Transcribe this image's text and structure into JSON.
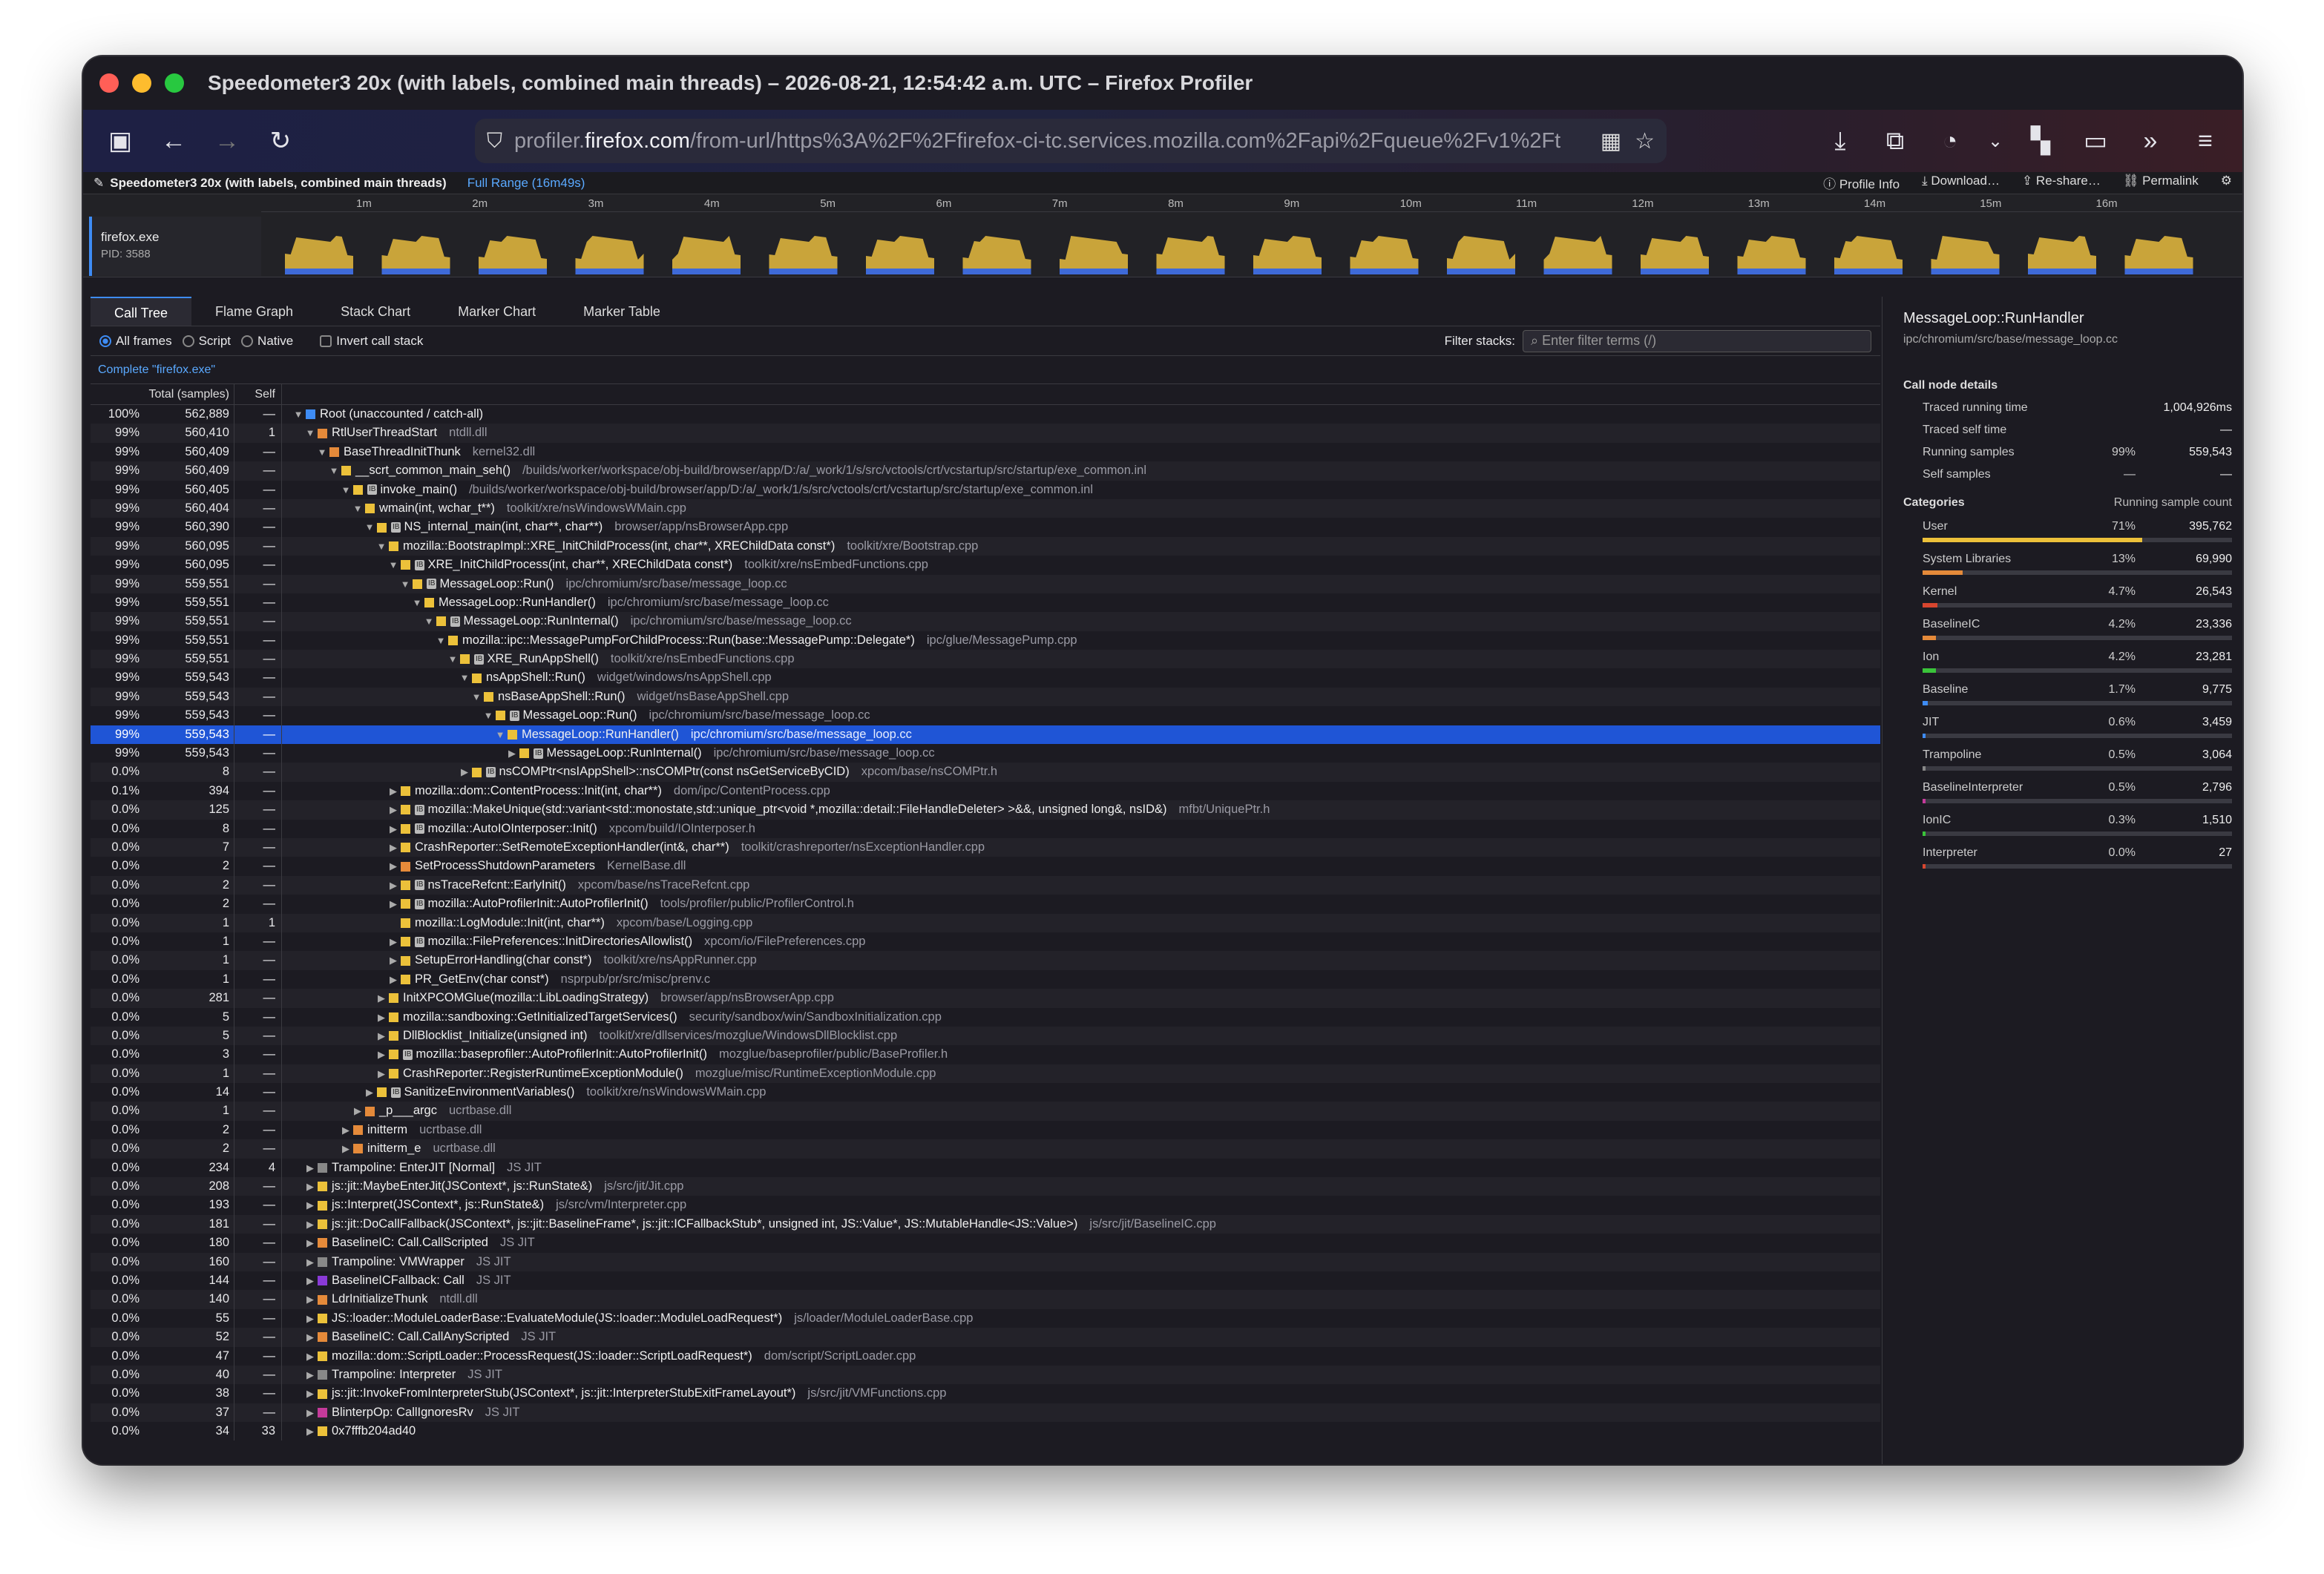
{
  "window": {
    "title": "Speedometer3 20x (with labels, combined main threads) – 2026-08-21, 12:54:42 a.m. UTC – Firefox Profiler"
  },
  "browser": {
    "url_prefix": "profiler.",
    "url_domain": "firefox.com",
    "url_path": "/from-url/https%3A%2F%2Ffirefox-ci-tc.services.mozilla.com%2Fapi%2Fqueue%2Fv1%2Ft"
  },
  "profile_header": {
    "name": "Speedometer3 20x (with labels, combined main threads)",
    "range": "Full Range (16m49s)",
    "buttons": [
      "Profile Info",
      "Download…",
      "Re-share…",
      "Permalink"
    ]
  },
  "timeline": {
    "ticks": [
      "1m",
      "2m",
      "3m",
      "4m",
      "5m",
      "6m",
      "7m",
      "8m",
      "9m",
      "10m",
      "11m",
      "12m",
      "13m",
      "14m",
      "15m",
      "16m"
    ],
    "track_name": "firefox.exe",
    "track_pid": "PID: 3588"
  },
  "tabs": [
    "Call Tree",
    "Flame Graph",
    "Stack Chart",
    "Marker Chart",
    "Marker Table"
  ],
  "settings": {
    "all_frames": "All frames",
    "script": "Script",
    "native": "Native",
    "invert": "Invert call stack",
    "filter_label": "Filter stacks:",
    "filter_placeholder": "Enter filter terms (/)"
  },
  "breadcrumb": "Complete \"firefox.exe\"",
  "columns": {
    "total": "Total (samples)",
    "self": "Self"
  },
  "colors": {
    "user": "#ecc13a",
    "syslib": "#e58a3a",
    "kernel": "#d7462f",
    "js": "#3e8cf5",
    "selected": "#1f55d6"
  },
  "rows": [
    {
      "pct": "100%",
      "total": "562,889",
      "self": "—",
      "depth": 0,
      "tw": "▼",
      "cat": "#3e8cf5",
      "ib": false,
      "name": "Root (unaccounted / catch-all)",
      "lib": ""
    },
    {
      "pct": "99%",
      "total": "560,410",
      "self": "1",
      "depth": 1,
      "tw": "▼",
      "cat": "#e58a3a",
      "ib": false,
      "name": "RtlUserThreadStart",
      "lib": "ntdll.dll"
    },
    {
      "pct": "99%",
      "total": "560,409",
      "self": "—",
      "depth": 2,
      "tw": "▼",
      "cat": "#e58a3a",
      "ib": false,
      "name": "BaseThreadInitThunk",
      "lib": "kernel32.dll"
    },
    {
      "pct": "99%",
      "total": "560,409",
      "self": "—",
      "depth": 3,
      "tw": "▼",
      "cat": "#ecc13a",
      "ib": false,
      "name": "__scrt_common_main_seh()",
      "lib": "/builds/worker/workspace/obj-build/browser/app/D:/a/_work/1/s/src/vctools/crt/vcstartup/src/startup/exe_common.inl"
    },
    {
      "pct": "99%",
      "total": "560,405",
      "self": "—",
      "depth": 4,
      "tw": "▼",
      "cat": "#ecc13a",
      "ib": true,
      "name": "invoke_main()",
      "lib": "/builds/worker/workspace/obj-build/browser/app/D:/a/_work/1/s/src/vctools/crt/vcstartup/src/startup/exe_common.inl"
    },
    {
      "pct": "99%",
      "total": "560,404",
      "self": "—",
      "depth": 5,
      "tw": "▼",
      "cat": "#ecc13a",
      "ib": false,
      "name": "wmain(int, wchar_t**)",
      "lib": "toolkit/xre/nsWindowsWMain.cpp"
    },
    {
      "pct": "99%",
      "total": "560,390",
      "self": "—",
      "depth": 6,
      "tw": "▼",
      "cat": "#ecc13a",
      "ib": true,
      "name": "NS_internal_main(int, char**, char**)",
      "lib": "browser/app/nsBrowserApp.cpp"
    },
    {
      "pct": "99%",
      "total": "560,095",
      "self": "—",
      "depth": 7,
      "tw": "▼",
      "cat": "#ecc13a",
      "ib": false,
      "name": "mozilla::BootstrapImpl::XRE_InitChildProcess(int, char**, XREChildData const*)",
      "lib": "toolkit/xre/Bootstrap.cpp"
    },
    {
      "pct": "99%",
      "total": "560,095",
      "self": "—",
      "depth": 8,
      "tw": "▼",
      "cat": "#ecc13a",
      "ib": true,
      "name": "XRE_InitChildProcess(int, char**, XREChildData const*)",
      "lib": "toolkit/xre/nsEmbedFunctions.cpp"
    },
    {
      "pct": "99%",
      "total": "559,551",
      "self": "—",
      "depth": 9,
      "tw": "▼",
      "cat": "#ecc13a",
      "ib": true,
      "name": "MessageLoop::Run()",
      "lib": "ipc/chromium/src/base/message_loop.cc"
    },
    {
      "pct": "99%",
      "total": "559,551",
      "self": "—",
      "depth": 10,
      "tw": "▼",
      "cat": "#ecc13a",
      "ib": false,
      "name": "MessageLoop::RunHandler()",
      "lib": "ipc/chromium/src/base/message_loop.cc"
    },
    {
      "pct": "99%",
      "total": "559,551",
      "self": "—",
      "depth": 11,
      "tw": "▼",
      "cat": "#ecc13a",
      "ib": true,
      "name": "MessageLoop::RunInternal()",
      "lib": "ipc/chromium/src/base/message_loop.cc"
    },
    {
      "pct": "99%",
      "total": "559,551",
      "self": "—",
      "depth": 12,
      "tw": "▼",
      "cat": "#ecc13a",
      "ib": false,
      "name": "mozilla::ipc::MessagePumpForChildProcess::Run(base::MessagePump::Delegate*)",
      "lib": "ipc/glue/MessagePump.cpp"
    },
    {
      "pct": "99%",
      "total": "559,551",
      "self": "—",
      "depth": 13,
      "tw": "▼",
      "cat": "#ecc13a",
      "ib": true,
      "name": "XRE_RunAppShell()",
      "lib": "toolkit/xre/nsEmbedFunctions.cpp"
    },
    {
      "pct": "99%",
      "total": "559,543",
      "self": "—",
      "depth": 14,
      "tw": "▼",
      "cat": "#ecc13a",
      "ib": false,
      "name": "nsAppShell::Run()",
      "lib": "widget/windows/nsAppShell.cpp"
    },
    {
      "pct": "99%",
      "total": "559,543",
      "self": "—",
      "depth": 15,
      "tw": "▼",
      "cat": "#ecc13a",
      "ib": false,
      "name": "nsBaseAppShell::Run()",
      "lib": "widget/nsBaseAppShell.cpp"
    },
    {
      "pct": "99%",
      "total": "559,543",
      "self": "—",
      "depth": 16,
      "tw": "▼",
      "cat": "#ecc13a",
      "ib": true,
      "name": "MessageLoop::Run()",
      "lib": "ipc/chromium/src/base/message_loop.cc"
    },
    {
      "pct": "99%",
      "total": "559,543",
      "self": "—",
      "depth": 17,
      "tw": "▼",
      "cat": "#ecc13a",
      "ib": false,
      "name": "MessageLoop::RunHandler()",
      "lib": "ipc/chromium/src/base/message_loop.cc",
      "sel": true
    },
    {
      "pct": "99%",
      "total": "559,543",
      "self": "—",
      "depth": 18,
      "tw": "▶",
      "cat": "#ecc13a",
      "ib": true,
      "name": "MessageLoop::RunInternal()",
      "lib": "ipc/chromium/src/base/message_loop.cc"
    },
    {
      "pct": "0.0%",
      "total": "8",
      "self": "—",
      "depth": 14,
      "tw": "▶",
      "cat": "#ecc13a",
      "ib": true,
      "name": "nsCOMPtr<nsIAppShell>::nsCOMPtr(const nsGetServiceByCID)",
      "lib": "xpcom/base/nsCOMPtr.h"
    },
    {
      "pct": "0.1%",
      "total": "394",
      "self": "—",
      "depth": 8,
      "tw": "▶",
      "cat": "#ecc13a",
      "ib": false,
      "name": "mozilla::dom::ContentProcess::Init(int, char**)",
      "lib": "dom/ipc/ContentProcess.cpp"
    },
    {
      "pct": "0.0%",
      "total": "125",
      "self": "—",
      "depth": 8,
      "tw": "▶",
      "cat": "#ecc13a",
      "ib": true,
      "name": "mozilla::MakeUnique(std::variant<std::monostate,std::unique_ptr<void *,mozilla::detail::FileHandleDeleter> >&&, unsigned long&, nsID&)",
      "lib": "mfbt/UniquePtr.h"
    },
    {
      "pct": "0.0%",
      "total": "8",
      "self": "—",
      "depth": 8,
      "tw": "▶",
      "cat": "#ecc13a",
      "ib": true,
      "name": "mozilla::AutoIOInterposer::Init()",
      "lib": "xpcom/build/IOInterposer.h"
    },
    {
      "pct": "0.0%",
      "total": "7",
      "self": "—",
      "depth": 8,
      "tw": "▶",
      "cat": "#ecc13a",
      "ib": false,
      "name": "CrashReporter::SetRemoteExceptionHandler(int&, char**)",
      "lib": "toolkit/crashreporter/nsExceptionHandler.cpp"
    },
    {
      "pct": "0.0%",
      "total": "2",
      "self": "—",
      "depth": 8,
      "tw": "▶",
      "cat": "#e58a3a",
      "ib": false,
      "name": "SetProcessShutdownParameters",
      "lib": "KernelBase.dll"
    },
    {
      "pct": "0.0%",
      "total": "2",
      "self": "—",
      "depth": 8,
      "tw": "▶",
      "cat": "#ecc13a",
      "ib": true,
      "name": "nsTraceRefcnt::EarlyInit()",
      "lib": "xpcom/base/nsTraceRefcnt.cpp"
    },
    {
      "pct": "0.0%",
      "total": "2",
      "self": "—",
      "depth": 8,
      "tw": "▶",
      "cat": "#ecc13a",
      "ib": true,
      "name": "mozilla::AutoProfilerInit::AutoProfilerInit()",
      "lib": "tools/profiler/public/ProfilerControl.h"
    },
    {
      "pct": "0.0%",
      "total": "1",
      "self": "1",
      "depth": 8,
      "tw": "",
      "cat": "#ecc13a",
      "ib": false,
      "name": "mozilla::LogModule::Init(int, char**)",
      "lib": "xpcom/base/Logging.cpp"
    },
    {
      "pct": "0.0%",
      "total": "1",
      "self": "—",
      "depth": 8,
      "tw": "▶",
      "cat": "#ecc13a",
      "ib": true,
      "name": "mozilla::FilePreferences::InitDirectoriesAllowlist()",
      "lib": "xpcom/io/FilePreferences.cpp"
    },
    {
      "pct": "0.0%",
      "total": "1",
      "self": "—",
      "depth": 8,
      "tw": "▶",
      "cat": "#ecc13a",
      "ib": false,
      "name": "SetupErrorHandling(char const*)",
      "lib": "toolkit/xre/nsAppRunner.cpp"
    },
    {
      "pct": "0.0%",
      "total": "1",
      "self": "—",
      "depth": 8,
      "tw": "▶",
      "cat": "#ecc13a",
      "ib": false,
      "name": "PR_GetEnv(char const*)",
      "lib": "nsprpub/pr/src/misc/prenv.c"
    },
    {
      "pct": "0.0%",
      "total": "281",
      "self": "—",
      "depth": 7,
      "tw": "▶",
      "cat": "#ecc13a",
      "ib": false,
      "name": "InitXPCOMGlue(mozilla::LibLoadingStrategy)",
      "lib": "browser/app/nsBrowserApp.cpp"
    },
    {
      "pct": "0.0%",
      "total": "5",
      "self": "—",
      "depth": 7,
      "tw": "▶",
      "cat": "#ecc13a",
      "ib": false,
      "name": "mozilla::sandboxing::GetInitializedTargetServices()",
      "lib": "security/sandbox/win/SandboxInitialization.cpp"
    },
    {
      "pct": "0.0%",
      "total": "5",
      "self": "—",
      "depth": 7,
      "tw": "▶",
      "cat": "#ecc13a",
      "ib": false,
      "name": "DllBlocklist_Initialize(unsigned int)",
      "lib": "toolkit/xre/dllservices/mozglue/WindowsDllBlocklist.cpp"
    },
    {
      "pct": "0.0%",
      "total": "3",
      "self": "—",
      "depth": 7,
      "tw": "▶",
      "cat": "#ecc13a",
      "ib": true,
      "name": "mozilla::baseprofiler::AutoProfilerInit::AutoProfilerInit()",
      "lib": "mozglue/baseprofiler/public/BaseProfiler.h"
    },
    {
      "pct": "0.0%",
      "total": "1",
      "self": "—",
      "depth": 7,
      "tw": "▶",
      "cat": "#ecc13a",
      "ib": false,
      "name": "CrashReporter::RegisterRuntimeExceptionModule()",
      "lib": "mozglue/misc/RuntimeExceptionModule.cpp"
    },
    {
      "pct": "0.0%",
      "total": "14",
      "self": "—",
      "depth": 6,
      "tw": "▶",
      "cat": "#ecc13a",
      "ib": true,
      "name": "SanitizeEnvironmentVariables()",
      "lib": "toolkit/xre/nsWindowsWMain.cpp"
    },
    {
      "pct": "0.0%",
      "total": "1",
      "self": "—",
      "depth": 5,
      "tw": "▶",
      "cat": "#e58a3a",
      "ib": false,
      "name": "_p___argc",
      "lib": "ucrtbase.dll"
    },
    {
      "pct": "0.0%",
      "total": "2",
      "self": "—",
      "depth": 4,
      "tw": "▶",
      "cat": "#e58a3a",
      "ib": false,
      "name": "initterm",
      "lib": "ucrtbase.dll"
    },
    {
      "pct": "0.0%",
      "total": "2",
      "self": "—",
      "depth": 4,
      "tw": "▶",
      "cat": "#e58a3a",
      "ib": false,
      "name": "initterm_e",
      "lib": "ucrtbase.dll"
    },
    {
      "pct": "0.0%",
      "total": "234",
      "self": "4",
      "depth": 1,
      "tw": "▶",
      "cat": "#888888",
      "ib": false,
      "name": "Trampoline: EnterJIT [Normal]",
      "lib": "JS JIT"
    },
    {
      "pct": "0.0%",
      "total": "208",
      "self": "—",
      "depth": 1,
      "tw": "▶",
      "cat": "#ecc13a",
      "ib": false,
      "name": "js::jit::MaybeEnterJit(JSContext*, js::RunState&)",
      "lib": "js/src/jit/Jit.cpp"
    },
    {
      "pct": "0.0%",
      "total": "193",
      "self": "—",
      "depth": 1,
      "tw": "▶",
      "cat": "#ecc13a",
      "ib": false,
      "name": "js::Interpret(JSContext*, js::RunState&)",
      "lib": "js/src/vm/Interpreter.cpp"
    },
    {
      "pct": "0.0%",
      "total": "181",
      "self": "—",
      "depth": 1,
      "tw": "▶",
      "cat": "#ecc13a",
      "ib": false,
      "name": "js::jit::DoCallFallback(JSContext*, js::jit::BaselineFrame*, js::jit::ICFallbackStub*, unsigned int, JS::Value*, JS::MutableHandle<JS::Value>)",
      "lib": "js/src/jit/BaselineIC.cpp"
    },
    {
      "pct": "0.0%",
      "total": "180",
      "self": "—",
      "depth": 1,
      "tw": "▶",
      "cat": "#e58a3a",
      "ib": false,
      "name": "BaselineIC: Call.CallScripted",
      "lib": "JS JIT"
    },
    {
      "pct": "0.0%",
      "total": "160",
      "self": "—",
      "depth": 1,
      "tw": "▶",
      "cat": "#888888",
      "ib": false,
      "name": "Trampoline: VMWrapper",
      "lib": "JS JIT"
    },
    {
      "pct": "0.0%",
      "total": "144",
      "self": "—",
      "depth": 1,
      "tw": "▶",
      "cat": "#8a3ad7",
      "ib": false,
      "name": "BaselineICFallback: Call",
      "lib": "JS JIT"
    },
    {
      "pct": "0.0%",
      "total": "140",
      "self": "—",
      "depth": 1,
      "tw": "▶",
      "cat": "#e58a3a",
      "ib": false,
      "name": "LdrInitializeThunk",
      "lib": "ntdll.dll"
    },
    {
      "pct": "0.0%",
      "total": "55",
      "self": "—",
      "depth": 1,
      "tw": "▶",
      "cat": "#ecc13a",
      "ib": false,
      "name": "JS::loader::ModuleLoaderBase::EvaluateModule(JS::loader::ModuleLoadRequest*)",
      "lib": "js/loader/ModuleLoaderBase.cpp"
    },
    {
      "pct": "0.0%",
      "total": "52",
      "self": "—",
      "depth": 1,
      "tw": "▶",
      "cat": "#e58a3a",
      "ib": false,
      "name": "BaselineIC: Call.CallAnyScripted",
      "lib": "JS JIT"
    },
    {
      "pct": "0.0%",
      "total": "47",
      "self": "—",
      "depth": 1,
      "tw": "▶",
      "cat": "#ecc13a",
      "ib": false,
      "name": "mozilla::dom::ScriptLoader::ProcessRequest(JS::loader::ScriptLoadRequest*)",
      "lib": "dom/script/ScriptLoader.cpp"
    },
    {
      "pct": "0.0%",
      "total": "40",
      "self": "—",
      "depth": 1,
      "tw": "▶",
      "cat": "#888888",
      "ib": false,
      "name": "Trampoline: Interpreter",
      "lib": "JS JIT"
    },
    {
      "pct": "0.0%",
      "total": "38",
      "self": "—",
      "depth": 1,
      "tw": "▶",
      "cat": "#ecc13a",
      "ib": false,
      "name": "js::jit::InvokeFromInterpreterStub(JSContext*, js::jit::InterpreterStubExitFrameLayout*)",
      "lib": "js/src/jit/VMFunctions.cpp"
    },
    {
      "pct": "0.0%",
      "total": "37",
      "self": "—",
      "depth": 1,
      "tw": "▶",
      "cat": "#c43a9a",
      "ib": false,
      "name": "BlinterpOp: CallIgnoresRv",
      "lib": "JS JIT"
    },
    {
      "pct": "0.0%",
      "total": "34",
      "self": "33",
      "depth": 1,
      "tw": "▶",
      "cat": "#ecc13a",
      "ib": false,
      "name": "0x7fffb204ad40",
      "lib": ""
    }
  ],
  "sidebar": {
    "title": "MessageLoop::RunHandler",
    "path": "ipc/chromium/src/base/message_loop.cc",
    "details_heading": "Call node details",
    "details": [
      {
        "k": "Traced running time",
        "v1": "",
        "v2": "1,004,926ms"
      },
      {
        "k": "Traced self time",
        "v1": "",
        "v2": "—"
      },
      {
        "k": "Running samples",
        "v1": "99%",
        "v2": "559,543"
      },
      {
        "k": "Self samples",
        "v1": "—",
        "v2": "—"
      }
    ],
    "categories_heading": "Categories",
    "categories_col": "Running sample count",
    "categories": [
      {
        "name": "User",
        "pct": "71%",
        "count": "395,762",
        "frac": 0.71,
        "color": "#ecc13a"
      },
      {
        "name": "System Libraries",
        "pct": "13%",
        "count": "69,990",
        "frac": 0.13,
        "color": "#e58a3a"
      },
      {
        "name": "Kernel",
        "pct": "4.7%",
        "count": "26,543",
        "frac": 0.047,
        "color": "#d7462f"
      },
      {
        "name": "BaselineIC",
        "pct": "4.2%",
        "count": "23,336",
        "frac": 0.042,
        "color": "#e58a3a"
      },
      {
        "name": "Ion",
        "pct": "4.2%",
        "count": "23,281",
        "frac": 0.042,
        "color": "#3ac43a"
      },
      {
        "name": "Baseline",
        "pct": "1.7%",
        "count": "9,775",
        "frac": 0.017,
        "color": "#3e8cf5"
      },
      {
        "name": "JIT",
        "pct": "0.6%",
        "count": "3,459",
        "frac": 0.006,
        "color": "#3e8cf5"
      },
      {
        "name": "Trampoline",
        "pct": "0.5%",
        "count": "3,064",
        "frac": 0.005,
        "color": "#888888"
      },
      {
        "name": "BaselineInterpreter",
        "pct": "0.5%",
        "count": "2,796",
        "frac": 0.005,
        "color": "#c43a9a"
      },
      {
        "name": "IonIC",
        "pct": "0.3%",
        "count": "1,510",
        "frac": 0.003,
        "color": "#3ac43a"
      },
      {
        "name": "Interpreter",
        "pct": "0.0%",
        "count": "27",
        "frac": 0.0,
        "color": "#d7462f"
      }
    ]
  }
}
